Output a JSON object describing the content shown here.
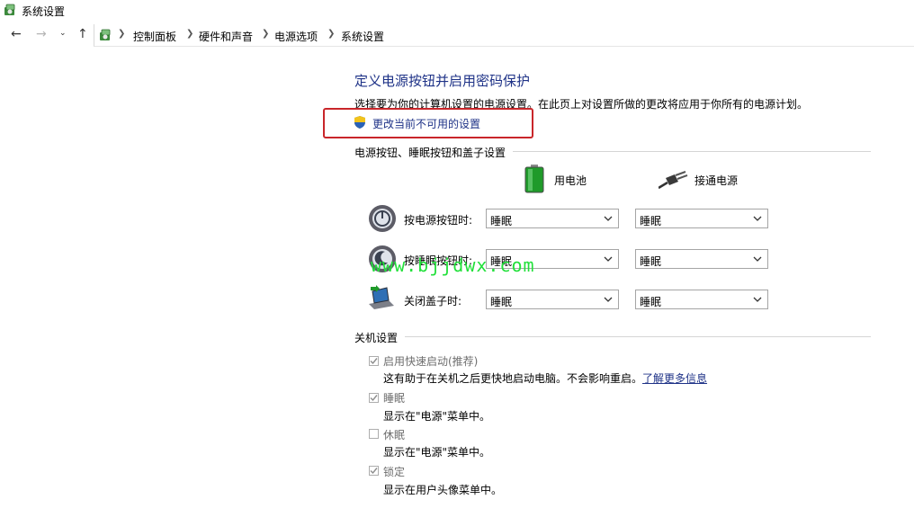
{
  "window": {
    "title": "系统设置"
  },
  "breadcrumbs": [
    "控制面板",
    "硬件和声音",
    "电源选项",
    "系统设置"
  ],
  "page": {
    "heading": "定义电源按钮并启用密码保护",
    "description": "选择要为你的计算机设置的电源设置。在此页上对设置所做的更改将应用于你所有的电源计划。",
    "change_link": "更改当前不可用的设置"
  },
  "power_buttons": {
    "section_title": "电源按钮、睡眠按钮和盖子设置",
    "battery_label": "用电池",
    "plugged_label": "接通电源",
    "rows": [
      {
        "label": "按电源按钮时:",
        "battery": "睡眠",
        "plugged": "睡眠"
      },
      {
        "label": "按睡眠按钮时:",
        "battery": "睡眠",
        "plugged": "睡眠"
      },
      {
        "label": "关闭盖子时:",
        "battery": "睡眠",
        "plugged": "睡眠"
      }
    ]
  },
  "shutdown": {
    "section_title": "关机设置",
    "items": [
      {
        "label": "启用快速启动(推荐)",
        "checked": true,
        "desc": "这有助于在关机之后更快地启动电脑。不会影响重启。",
        "link": "了解更多信息"
      },
      {
        "label": "睡眠",
        "checked": true,
        "desc": "显示在\"电源\"菜单中。"
      },
      {
        "label": "休眠",
        "checked": false,
        "desc": "显示在\"电源\"菜单中。"
      },
      {
        "label": "锁定",
        "checked": true,
        "desc": "显示在用户头像菜单中。"
      }
    ]
  },
  "watermark": "www.bjjdwx.com",
  "colors": {
    "link": "#1e3287",
    "highlight_box": "#c9262a",
    "watermark": "#21e03a"
  }
}
